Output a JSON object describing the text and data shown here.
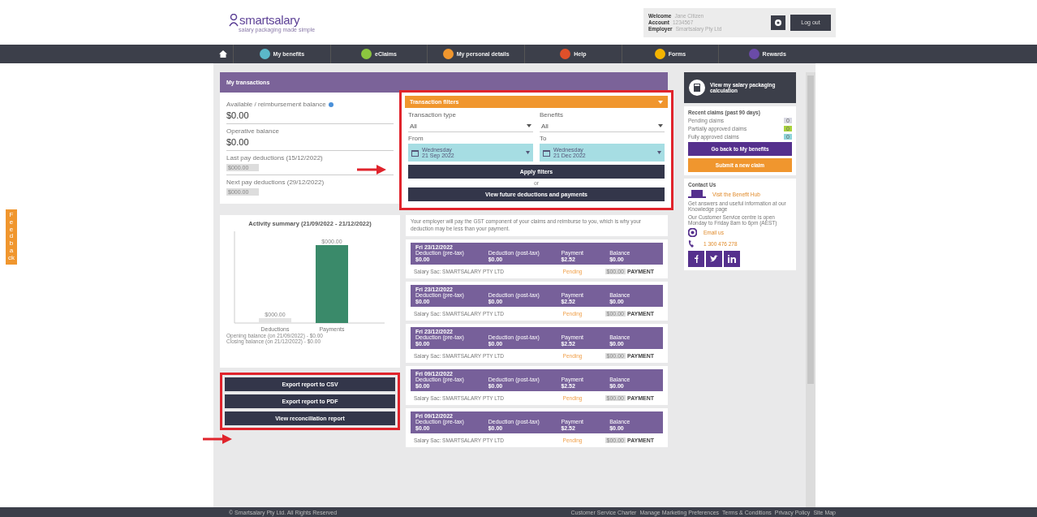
{
  "header": {
    "logo": {
      "name": "smartsalary",
      "tagline": "salary packaging made simple"
    },
    "user_info": [
      {
        "label": "Welcome",
        "value": "Jane Citizen"
      },
      {
        "label": "Account",
        "value": "1234567"
      },
      {
        "label": "Employer",
        "value": "Smartsalary Pty Ltd"
      }
    ],
    "logout_button": "Log out"
  },
  "nav": [
    {
      "label": "My benefits",
      "color": "#5bb8c9"
    },
    {
      "label": "eClaims",
      "color": "#8cc63f"
    },
    {
      "label": "My personal details",
      "color": "#f0962e"
    },
    {
      "label": "Help",
      "color": "#e0502a"
    },
    {
      "label": "Forms",
      "color": "#f4b400"
    },
    {
      "label": "Rewards",
      "color": "#6a4ba8"
    }
  ],
  "feedback_tab": "Feedback",
  "page_title": "My transactions",
  "balances": [
    {
      "label": "Available / reimbursement balance",
      "value": "$0.00",
      "kind": "amount",
      "info": true
    },
    {
      "label": "Operative balance",
      "value": "$0.00",
      "kind": "amount",
      "info": false
    },
    {
      "label": "Last pay deductions (15/12/2022)",
      "value": "$000.00",
      "kind": "masked",
      "info": false
    },
    {
      "label": "Next pay deductions (29/12/2022)",
      "value": "$000.00",
      "kind": "masked",
      "info": false
    }
  ],
  "activity": {
    "title": "Activity summary (21/09/2022 - 21/12/2022)",
    "bars": [
      {
        "label": "Deductions",
        "value_label": "$000.00"
      },
      {
        "label": "Payments",
        "value_label": "$000.00"
      }
    ],
    "summary": [
      "Opening balance (on 21/09/2022) - $0.00",
      "Closing balance (on 21/12/2022) - $0.00"
    ]
  },
  "report_buttons": [
    "Export report to CSV",
    "Export report to PDF",
    "View reconciliation report"
  ],
  "filters": {
    "title": "Transaction filters",
    "fields": [
      {
        "label": "Transaction type",
        "kind": "select",
        "value": "All"
      },
      {
        "label": "Benefits",
        "kind": "select",
        "value": "All"
      },
      {
        "label": "From",
        "kind": "date",
        "day": "Wednesday",
        "value": "21 Sep 2022"
      },
      {
        "label": "To",
        "kind": "date",
        "day": "Wednesday",
        "value": "21 Dec 2022"
      }
    ],
    "apply_button": "Apply filters",
    "separator": "or",
    "future_button": "View future deductions and payments"
  },
  "note": "Your employer will pay the GST component of your claims and reimburse to you, which is why your deduction may be less than your payment.",
  "transactions": [
    {
      "date": "Fri 23/12/2022",
      "columns": [
        {
          "label": "Deduction (pre-tax)",
          "value": "$0.00"
        },
        {
          "label": "Deduction (post-tax)",
          "value": "$0.00"
        },
        {
          "label": "Payment",
          "value": "$2.52"
        },
        {
          "label": "Balance",
          "value": "$0.00"
        }
      ],
      "description": "Salary Sac: SMARTSALARY PTY LTD",
      "status": "Pending",
      "amount": "$00.00",
      "type": "PAYMENT"
    },
    {
      "date": "Fri 23/12/2022",
      "columns": [
        {
          "label": "Deduction (pre-tax)",
          "value": "$0.00"
        },
        {
          "label": "Deduction (post-tax)",
          "value": "$0.00"
        },
        {
          "label": "Payment",
          "value": "$2.52"
        },
        {
          "label": "Balance",
          "value": "$0.00"
        }
      ],
      "description": "Salary Sac: SMARTSALARY PTY LTD",
      "status": "Pending",
      "amount": "$00.00",
      "type": "PAYMENT"
    },
    {
      "date": "Fri 23/12/2022",
      "columns": [
        {
          "label": "Deduction (pre-tax)",
          "value": "$0.00"
        },
        {
          "label": "Deduction (post-tax)",
          "value": "$0.00"
        },
        {
          "label": "Payment",
          "value": "$2.52"
        },
        {
          "label": "Balance",
          "value": "$0.00"
        }
      ],
      "description": "Salary Sac: SMARTSALARY PTY LTD",
      "status": "Pending",
      "amount": "$00.00",
      "type": "PAYMENT"
    },
    {
      "date": "Fri 09/12/2022",
      "columns": [
        {
          "label": "Deduction (pre-tax)",
          "value": "$0.00"
        },
        {
          "label": "Deduction (post-tax)",
          "value": "$0.00"
        },
        {
          "label": "Payment",
          "value": "$2.52"
        },
        {
          "label": "Balance",
          "value": "$0.00"
        }
      ],
      "description": "Salary Sac: SMARTSALARY PTY LTD",
      "status": "Pending",
      "amount": "$00.00",
      "type": "PAYMENT"
    },
    {
      "date": "Fri 09/12/2022",
      "columns": [
        {
          "label": "Deduction (pre-tax)",
          "value": "$0.00"
        },
        {
          "label": "Deduction (post-tax)",
          "value": "$0.00"
        },
        {
          "label": "Payment",
          "value": "$2.52"
        },
        {
          "label": "Balance",
          "value": "$0.00"
        }
      ],
      "description": "Salary Sac: SMARTSALARY PTY LTD",
      "status": "Pending",
      "amount": "$00.00",
      "type": "PAYMENT"
    }
  ],
  "sidebar": {
    "calculation_button": "View my salary packaging calculation",
    "claims_title": "Recent claims (past 90 days)",
    "claims": [
      {
        "label": "Pending claims",
        "count": "0",
        "color": "#d9d9e3"
      },
      {
        "label": "Partially approved claims",
        "count": "0",
        "color": "#a8d23c"
      },
      {
        "label": "Fully approved claims",
        "count": "0",
        "color": "#8fd4d9"
      }
    ],
    "back_button": "Go back to My benefits",
    "claim_button": "Submit a new claim",
    "contact_title": "Contact Us",
    "hub_link": "Visit the Benefit Hub",
    "help_text": "Get answers and useful information at our Knowledge page",
    "hours_text": "Our Customer Service centre is open Monday to Friday 8am to 6pm (AEST)",
    "email_link": "Email us",
    "phone_link": "1 300 476 278"
  },
  "footer": {
    "copyright": "© Smartsalary Pty Ltd. All Rights Reserved",
    "links": [
      "Customer Service Charter",
      "Manage Marketing Preferences",
      "Terms & Conditions",
      "Privacy Policy",
      "Site Map"
    ]
  }
}
